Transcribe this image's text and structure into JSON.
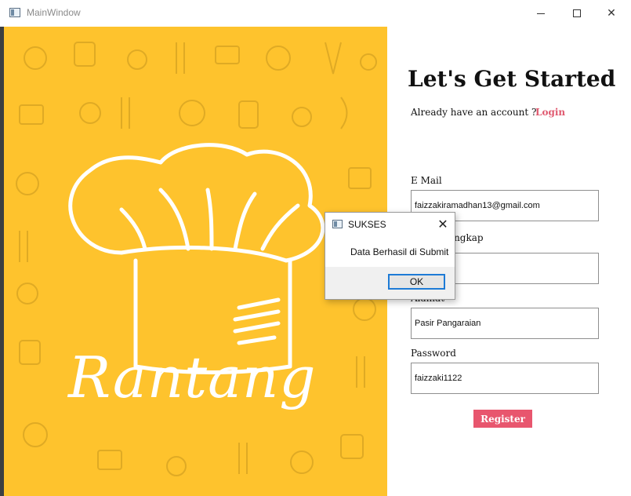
{
  "window": {
    "title": "MainWindow",
    "min_icon": "minimize-icon",
    "max_icon": "maximize-icon",
    "close_icon": "close-icon"
  },
  "poster": {
    "brand": "Rantang",
    "background_color": "#fec32d",
    "hat_icon": "chef-hat-icon"
  },
  "form": {
    "heading": "Let's Get Started",
    "already_text": "Already have an account ?",
    "login_link": "Login",
    "fields": [
      {
        "label": "E Mail",
        "value": "faizzakiramadhan13@gmail.com"
      },
      {
        "label": "Nama Lengkap",
        "value": ""
      },
      {
        "label": "Alamat",
        "value": "Pasir Pangaraian"
      },
      {
        "label": "Password",
        "value": "faizzaki1122"
      }
    ],
    "register_label": "Register",
    "accent_color": "#e8566e"
  },
  "dialog": {
    "title": "SUKSES",
    "message": "Data Berhasil di Submit",
    "ok_label": "OK",
    "close_glyph": "✕"
  }
}
